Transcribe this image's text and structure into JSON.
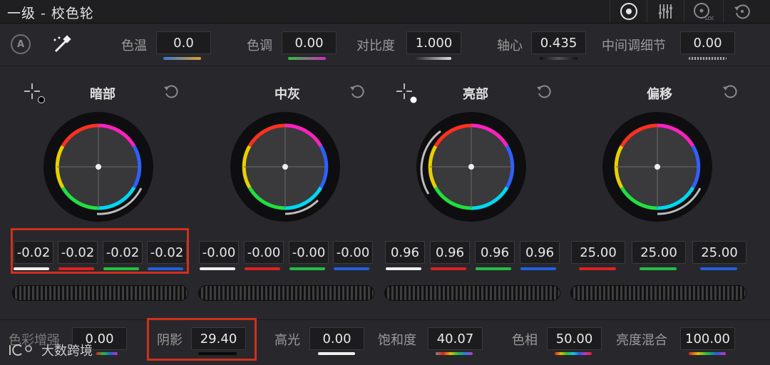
{
  "window": {
    "title": "一级 - 校色轮"
  },
  "toolbar": {
    "icons": [
      "color-wheels-icon",
      "primary-bars-icon",
      "log-wheels-icon",
      "reset-all-icon"
    ]
  },
  "primary_params": {
    "auto_label": "A",
    "temp_label": "色温",
    "temp_value": "0.0",
    "tint_label": "色调",
    "tint_value": "0.00",
    "contrast_label": "对比度",
    "contrast_value": "1.000",
    "pivot_label": "轴心",
    "pivot_value": "0.435",
    "middetail_label": "中间调细节",
    "middetail_value": "0.00"
  },
  "wheels": [
    {
      "title": "暗部",
      "values": [
        "-0.02",
        "-0.02",
        "-0.02",
        "-0.02"
      ]
    },
    {
      "title": "中灰",
      "values": [
        "-0.00",
        "-0.00",
        "-0.00",
        "-0.00"
      ]
    },
    {
      "title": "亮部",
      "values": [
        "0.96",
        "0.96",
        "0.96",
        "0.96"
      ]
    },
    {
      "title": "偏移",
      "values": [
        "25.00",
        "25.00",
        "25.00"
      ]
    }
  ],
  "bottom_params": {
    "colorboost_label": "色彩增强",
    "colorboost_value": "0.00",
    "shadow_label": "阴影",
    "shadow_value": "29.40",
    "highlight_label": "高光",
    "highlight_value": "0.00",
    "saturation_label": "饱和度",
    "saturation_value": "40.07",
    "hue_label": "色相",
    "hue_value": "50.00",
    "lummix_label": "亮度混合",
    "lummix_value": "100.00"
  },
  "watermark": {
    "text": "大数跨境"
  },
  "colors": {
    "accent_red": "#d0301c",
    "channel_red": "#e02020",
    "channel_green": "#22c040",
    "channel_blue": "#2060e0"
  }
}
